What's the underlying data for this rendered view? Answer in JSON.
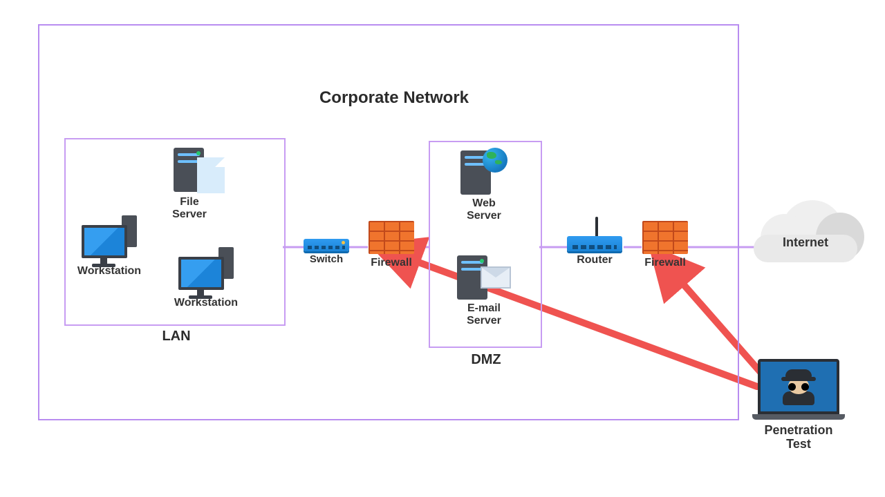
{
  "title": "Corporate Network",
  "zones": {
    "lan": "LAN",
    "dmz": "DMZ"
  },
  "nodes": {
    "workstation1": "Workstation",
    "workstation2": "Workstation",
    "file_server": "File\nServer",
    "switch": "Switch",
    "firewall_inner": "Firewall",
    "web_server": "Web\nServer",
    "email_server": "E-mail\nServer",
    "router": "Router",
    "firewall_outer": "Firewall",
    "internet": "Internet",
    "pentest": "Penetration\nTest"
  }
}
